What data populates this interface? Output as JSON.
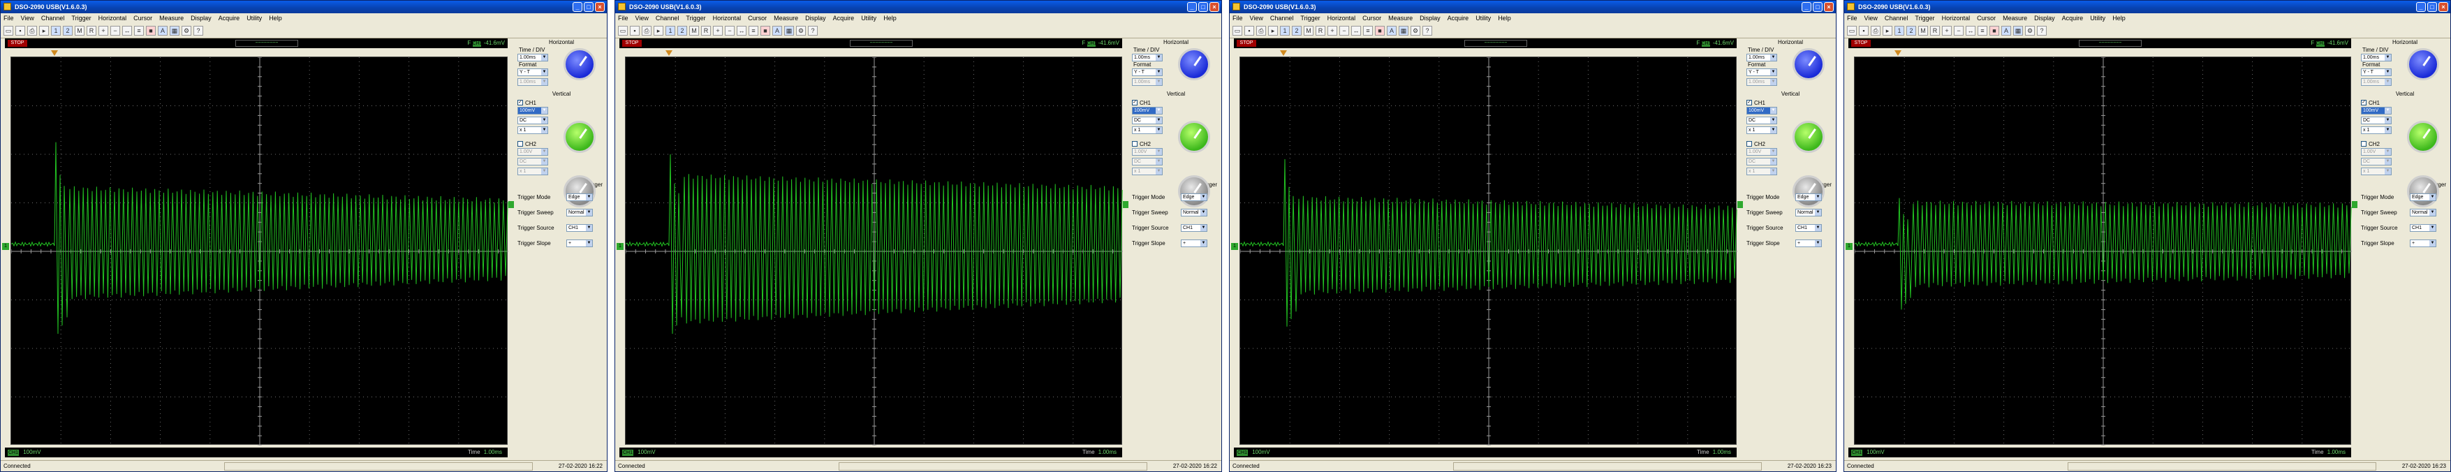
{
  "window_title": "DSO-2090 USB(V1.6.0.3)",
  "menu": [
    "File",
    "View",
    "Channel",
    "Trigger",
    "Horizontal",
    "Cursor",
    "Measure",
    "Display",
    "Acquire",
    "Utility",
    "Help"
  ],
  "toolbar_icons": [
    "open-icon",
    "save-icon",
    "print-icon",
    "run-icon",
    "ch1-icon",
    "ch2-icon",
    "math-icon",
    "ref-icon",
    "zoom-in-icon",
    "zoom-out-icon",
    "cursor-icon",
    "measure-icon",
    "stop-icon",
    "autoset-icon",
    "display-icon",
    "settings-icon",
    "help-icon"
  ],
  "status_strip": {
    "state": "STOP",
    "trigger_icon": "~~~~~~~~",
    "trigger_channel": "F",
    "trigger_badge": "CH1",
    "trigger_level": "-41.6mV"
  },
  "horizontal": {
    "title": "Horizontal",
    "time_div_label": "Time / DIV",
    "time_div_value": "1.00ms",
    "format_label": "Format",
    "format_value": "Y - T",
    "extra_value": "1.00ms"
  },
  "vertical": {
    "title": "Vertical",
    "ch1": {
      "label": "CH1",
      "volt_div": "100mV",
      "coupling": "DC",
      "probe": "x 1"
    },
    "ch2": {
      "label": "CH2",
      "volt_div": "1.00V",
      "coupling": "DC",
      "probe": "x 1"
    }
  },
  "trigger": {
    "title": "Trigger",
    "mode_label": "Trigger Mode",
    "mode_value": "Edge",
    "sweep_label": "Trigger Sweep",
    "sweep_value": "Normal",
    "source_label": "Trigger Source",
    "source_value": "CH1",
    "slope_label": "Trigger Slope",
    "slope_value": "+"
  },
  "bottom": {
    "ch1_badge": "CH1",
    "ch1_scale": "100mV",
    "time_label": "Time",
    "time_value": "1.00ms"
  },
  "statusbar": {
    "connection": "Connected",
    "datetime": "27-02-2020 16:22"
  },
  "windows": [
    {
      "status_strip": {
        "state": "STOP"
      },
      "statusbar": {
        "datetime": "27-02-2020 16:22"
      }
    },
    {
      "status_strip": {
        "state": "STOP"
      },
      "statusbar": {
        "datetime": "27-02-2020 16:22"
      }
    },
    {
      "status_strip": {
        "state": "STOP"
      },
      "statusbar": {
        "datetime": "27-02-2020 16:23"
      }
    },
    {
      "status_strip": {
        "state": "STOP"
      },
      "statusbar": {
        "datetime": "27-02-2020 16:23"
      }
    }
  ],
  "waveforms": [
    {
      "flat_level": 0.0,
      "spike_top": 2.25,
      "spike_bottom": -1.7,
      "env_start": 1.3,
      "env_end": 1.05,
      "env_low_start": -0.95,
      "env_low_end": -0.55
    },
    {
      "flat_level": 0.0,
      "spike_top": 2.0,
      "spike_bottom": -1.7,
      "env_start": 1.55,
      "env_end": 1.3,
      "env_low_start": -1.45,
      "env_low_end": -1.0
    },
    {
      "flat_level": 0.0,
      "spike_top": 1.9,
      "spike_bottom": -1.55,
      "env_start": 1.1,
      "env_end": 0.9,
      "env_low_start": -0.85,
      "env_low_end": -0.6
    },
    {
      "flat_level": 0.0,
      "spike_top": 1.1,
      "spike_bottom": -1.2,
      "env_start": 1.0,
      "env_end": 0.95,
      "env_low_start": -0.7,
      "env_low_end": -0.5
    }
  ],
  "colors": {
    "trace": "#22c422",
    "grid": "#6e6e6e",
    "scope_bg": "#000000",
    "accent_green": "#2ea82e"
  }
}
